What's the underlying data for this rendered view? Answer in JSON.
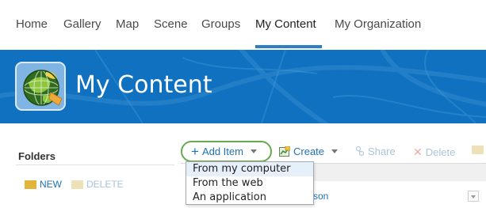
{
  "nav": {
    "items": [
      {
        "label": "Home"
      },
      {
        "label": "Gallery"
      },
      {
        "label": "Map"
      },
      {
        "label": "Scene"
      },
      {
        "label": "Groups"
      },
      {
        "label": "My Content"
      },
      {
        "label": "My Organization"
      }
    ],
    "active": "My Content"
  },
  "banner": {
    "title": "My Content",
    "logo_icon": "globe-logo-icon"
  },
  "folders": {
    "heading": "Folders",
    "new_label": "NEW",
    "delete_label": "DELETE"
  },
  "toolbar": {
    "add_item_label": "Add Item",
    "create_label": "Create",
    "share_label": "Share",
    "delete_label": "Delete",
    "highlight_color": "#6aa84f"
  },
  "add_item_menu": {
    "items": [
      {
        "label": "From my computer"
      },
      {
        "label": "From the web"
      },
      {
        "label": "An application"
      }
    ]
  },
  "table": {
    "partial_owner_text": "son"
  },
  "colors": {
    "banner": "#0f71c0",
    "link": "#1e72b3",
    "disabled": "#a9c3d9",
    "nav_active": "#2f7fc0"
  }
}
